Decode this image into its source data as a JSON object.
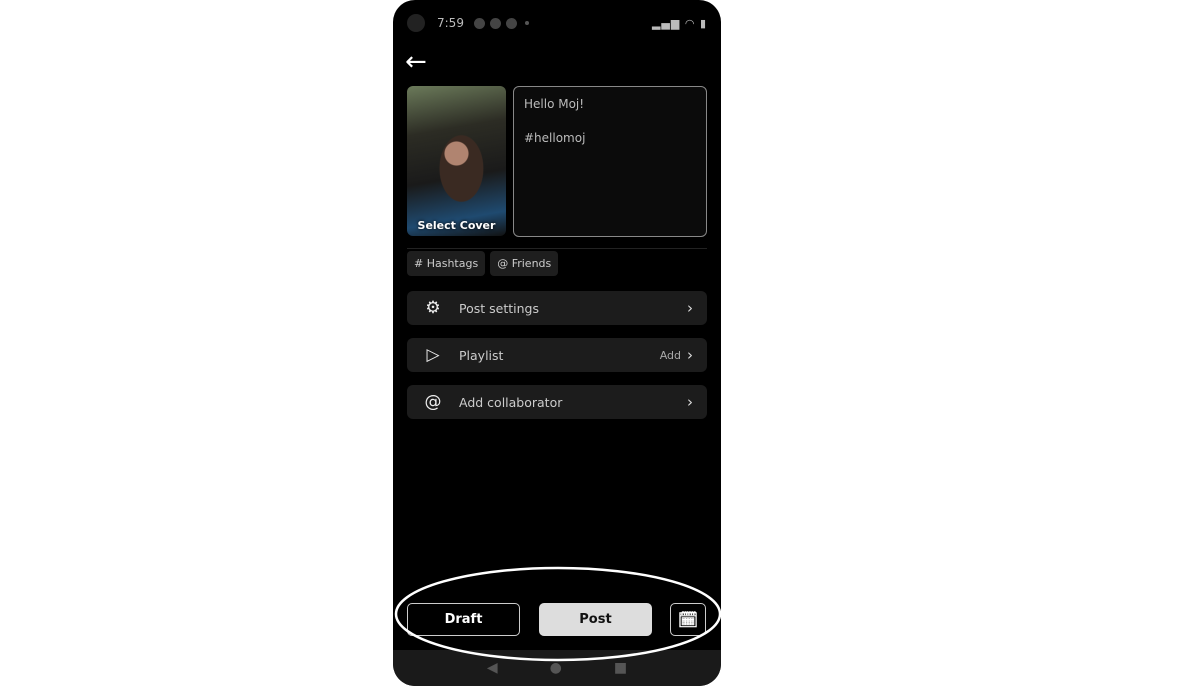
{
  "status_bar": {
    "time": "7:59",
    "icons": "signal wifi battery"
  },
  "header": {
    "back_icon": "arrow-left-icon"
  },
  "cover": {
    "label": "Select Cover"
  },
  "caption": {
    "line1": "Hello Moj!",
    "line2": "#hellomoj"
  },
  "chips": [
    {
      "label": "# Hashtags"
    },
    {
      "label": "@ Friends"
    }
  ],
  "rows": [
    {
      "label": "Post settings",
      "icon": "post-settings-icon",
      "extra": ""
    },
    {
      "label": "Playlist",
      "icon": "playlist-add-icon",
      "extra": "Add"
    },
    {
      "label": "Add collaborator",
      "icon": "at-icon",
      "extra": ""
    }
  ],
  "footer": {
    "draft": "Draft",
    "post": "Post",
    "schedule_icon": "calendar-clock-icon"
  },
  "annotation": {
    "color": "#ffffff"
  }
}
